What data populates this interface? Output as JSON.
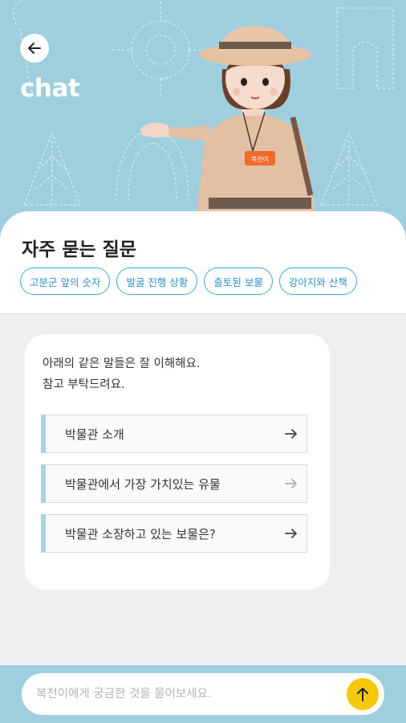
{
  "header": {
    "title": "chat",
    "back_icon": "arrow-left-icon",
    "badge_text": "복천이",
    "colors": {
      "sky": "#9fcfdf",
      "accent": "#f5c90a",
      "chip_border": "#3aa6d6"
    }
  },
  "faq": {
    "title": "자주 묻는 질문",
    "chips": [
      {
        "label": "고분군 앞의 숫자"
      },
      {
        "label": "발굴 진행 상황"
      },
      {
        "label": "출토된 보물"
      },
      {
        "label": "강아지와 산책"
      }
    ]
  },
  "chat": {
    "intro_line1": "아래의 같은 말들은 잘 이해해요.",
    "intro_line2": "참고 부탁드려요.",
    "options": [
      {
        "label": "박물관 소개",
        "icon": "arrow-right-icon"
      },
      {
        "label": "박물관에서 가장 가치있는 유물",
        "icon": "arrow-right-icon"
      },
      {
        "label": "박물관 소장하고 있는 보물은?",
        "icon": "arrow-right-icon"
      }
    ]
  },
  "input": {
    "placeholder": "복천이에게 궁금한 것을 물어보세요.",
    "value": "",
    "send_icon": "arrow-up-icon"
  }
}
